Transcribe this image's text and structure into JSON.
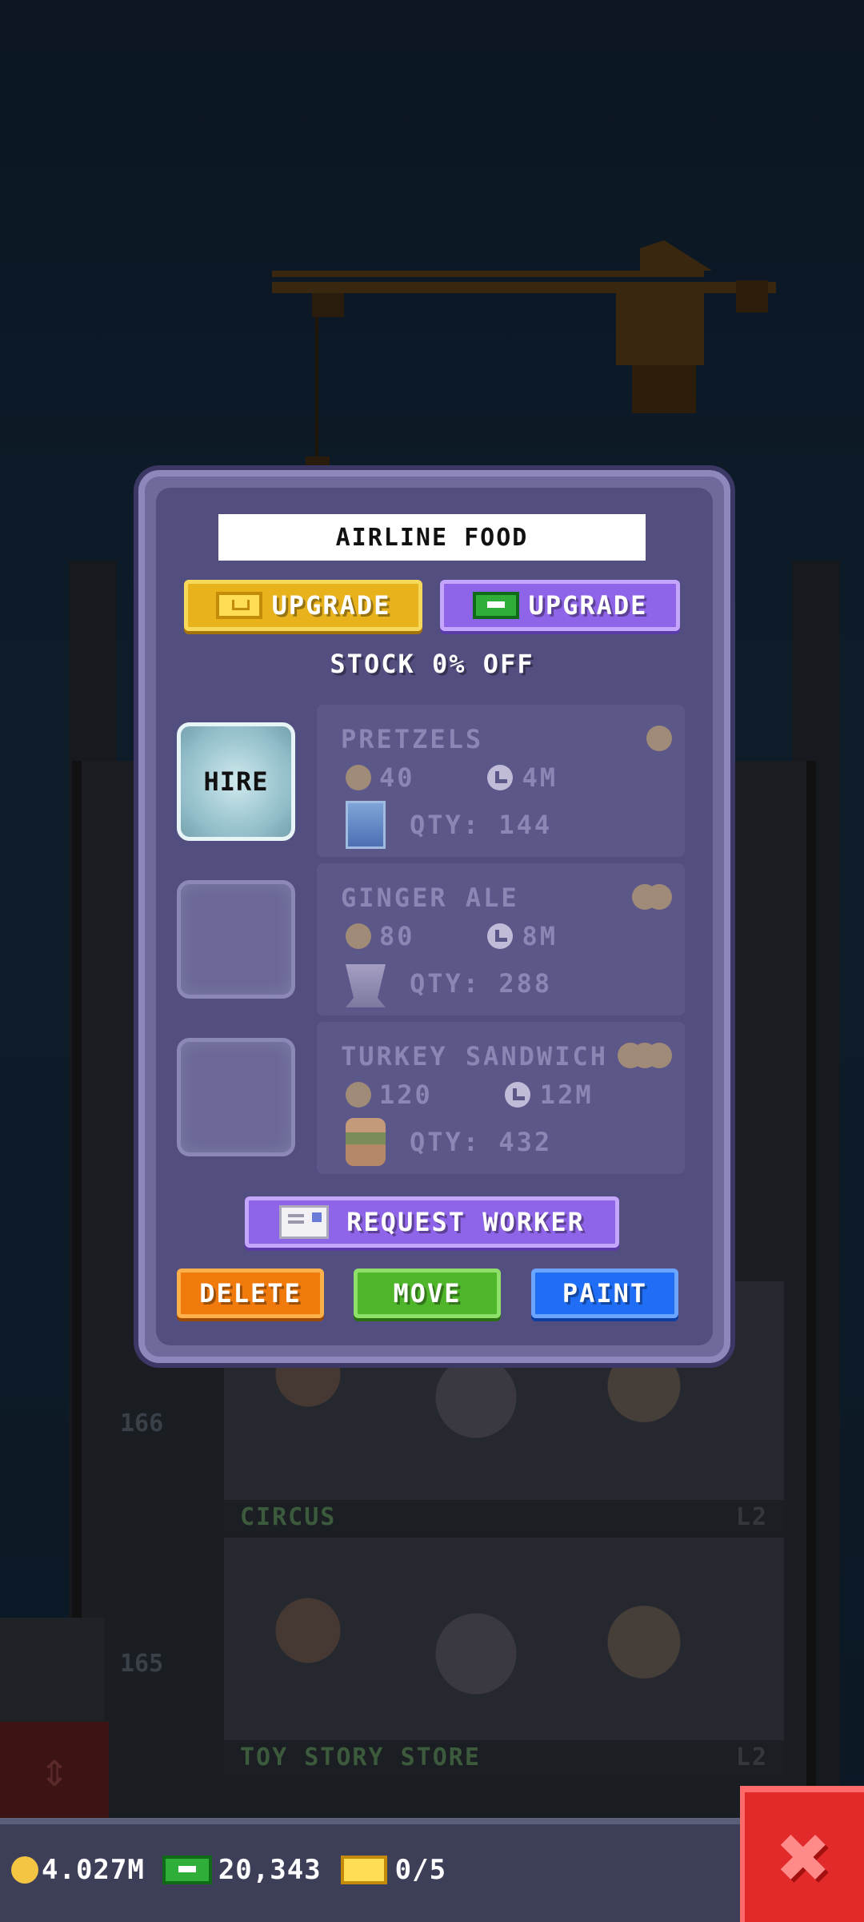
{
  "room": {
    "title": "AIRLINE FOOD",
    "upgrade_tickets_label": "UPGRADE",
    "upgrade_bux_label": "UPGRADE",
    "stock_discount_text": "STOCK 0% OFF",
    "hire_label": "HIRE",
    "products": [
      {
        "name": "PRETZELS",
        "cost": "40",
        "time": "4M",
        "qty": "QTY: 144",
        "icon": "can-icon",
        "tier_coins": 1
      },
      {
        "name": "GINGER ALE",
        "cost": "80",
        "time": "8M",
        "qty": "QTY: 288",
        "icon": "cup-icon",
        "tier_coins": 2
      },
      {
        "name": "TURKEY SANDWICH",
        "cost": "120",
        "time": "12M",
        "qty": "QTY: 432",
        "icon": "sandwich-icon",
        "tier_coins": 3
      }
    ],
    "request_worker_label": "REQUEST WORKER",
    "delete_label": "DELETE",
    "move_label": "MOVE",
    "paint_label": "PAINT"
  },
  "background": {
    "floors": [
      {
        "number": "166",
        "name": "CIRCUS",
        "level": "L2"
      },
      {
        "number": "165",
        "name": "TOY STORY STORE",
        "level": "L2"
      }
    ]
  },
  "status_bar": {
    "coins": "4.027M",
    "bux": "20,343",
    "tickets": "0/5"
  },
  "close_icon": "close-x-icon",
  "colors": {
    "modal_bg": "#534e80",
    "gold_button": "#e8b21d",
    "purple_button": "#8e64e8",
    "delete_button": "#f07a0c",
    "move_button": "#4fb52a",
    "paint_button": "#1f6ef5",
    "close_button": "#e22a2a"
  }
}
